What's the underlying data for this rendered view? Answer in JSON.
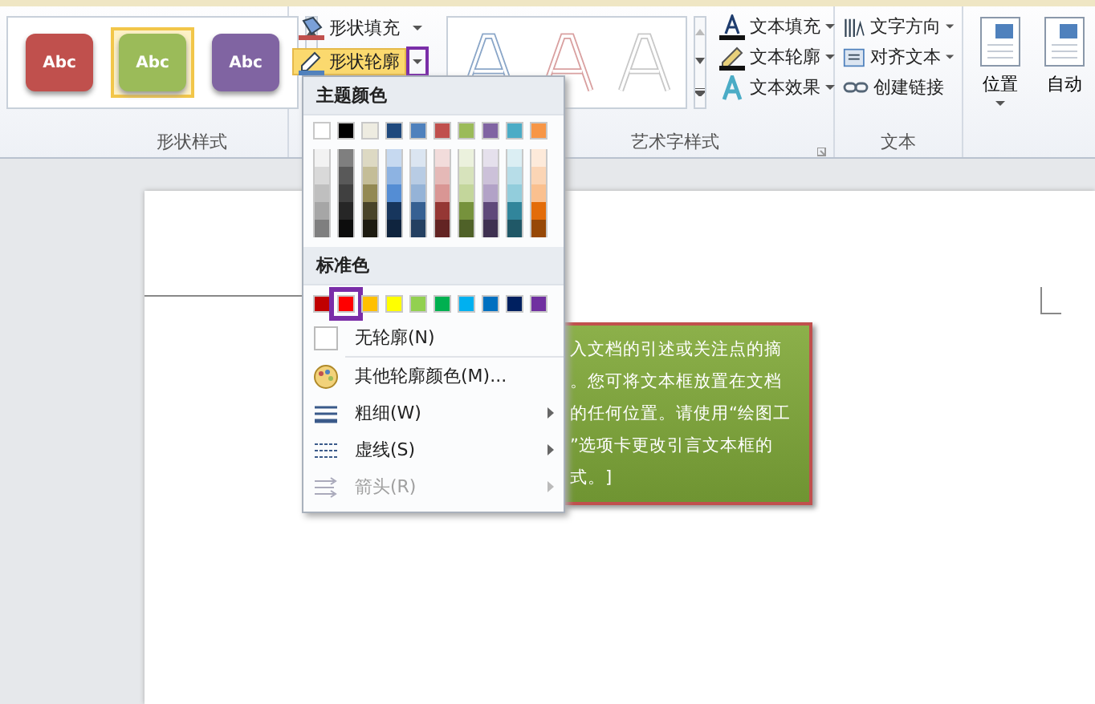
{
  "ribbon": {
    "shape_styles": {
      "label": "形状样式",
      "presets": [
        {
          "text": "Abc",
          "color": "#c0504d",
          "selected": false
        },
        {
          "text": "Abc",
          "color": "#9bbb59",
          "selected": true
        },
        {
          "text": "Abc",
          "color": "#8064a2",
          "selected": false
        }
      ]
    },
    "shape_commands": [
      {
        "kind": "fill",
        "label": "形状填充",
        "expanded": false
      },
      {
        "kind": "outline",
        "label": "形状轮廓",
        "expanded": true
      }
    ],
    "wordart_styles": {
      "label": "艺术字样式",
      "commands": [
        {
          "kind": "fill",
          "label": "文本填充"
        },
        {
          "kind": "outline",
          "label": "文本轮廓"
        },
        {
          "kind": "effect",
          "label": "文本效果"
        }
      ]
    },
    "text_group": {
      "label": "文本",
      "commands": [
        {
          "kind": "direction",
          "label": "文字方向",
          "dropdown": true
        },
        {
          "kind": "align",
          "label": "对齐文本",
          "dropdown": true
        },
        {
          "kind": "link",
          "label": "创建链接",
          "dropdown": false
        }
      ]
    },
    "arrange": [
      {
        "kind": "position",
        "label": "位置"
      },
      {
        "kind": "wrap",
        "label": "自动"
      }
    ]
  },
  "outline_menu": {
    "theme_heading": "主题颜色",
    "theme_colors": [
      {
        "color": "#ffffff",
        "shades": [
          {
            "color": "#f2f2f2"
          },
          {
            "color": "#d9d9d9"
          },
          {
            "color": "#bfbfbf"
          },
          {
            "color": "#a6a6a6"
          },
          {
            "color": "#7f7f7f"
          }
        ]
      },
      {
        "color": "#000000",
        "shades": [
          {
            "color": "#7f7f7f"
          },
          {
            "color": "#595959"
          },
          {
            "color": "#404040"
          },
          {
            "color": "#262626"
          },
          {
            "color": "#0d0d0d"
          }
        ]
      },
      {
        "color": "#eeece1",
        "shades": [
          {
            "color": "#ddd9c3"
          },
          {
            "color": "#c4bd97"
          },
          {
            "color": "#938953"
          },
          {
            "color": "#494429"
          },
          {
            "color": "#1d1b10"
          }
        ]
      },
      {
        "color": "#1f497d",
        "shades": [
          {
            "color": "#c6d9f0"
          },
          {
            "color": "#8db3e2"
          },
          {
            "color": "#548dd4"
          },
          {
            "color": "#17365d"
          },
          {
            "color": "#0f243e"
          }
        ]
      },
      {
        "color": "#4f81bd",
        "shades": [
          {
            "color": "#dbe5f1"
          },
          {
            "color": "#b8cce4"
          },
          {
            "color": "#95b3d7"
          },
          {
            "color": "#366092"
          },
          {
            "color": "#244061"
          }
        ]
      },
      {
        "color": "#c0504d",
        "shades": [
          {
            "color": "#f2dcdb"
          },
          {
            "color": "#e5b9b7"
          },
          {
            "color": "#d99694"
          },
          {
            "color": "#953734"
          },
          {
            "color": "#632423"
          }
        ]
      },
      {
        "color": "#9bbb59",
        "shades": [
          {
            "color": "#ebf1dd"
          },
          {
            "color": "#d7e3bc"
          },
          {
            "color": "#c3d69b"
          },
          {
            "color": "#76923c"
          },
          {
            "color": "#4f6128"
          }
        ]
      },
      {
        "color": "#8064a2",
        "shades": [
          {
            "color": "#e5e0ec"
          },
          {
            "color": "#ccc1d9"
          },
          {
            "color": "#b2a2c7"
          },
          {
            "color": "#5f497a"
          },
          {
            "color": "#3f3151"
          }
        ]
      },
      {
        "color": "#4bacc6",
        "shades": [
          {
            "color": "#dbeef3"
          },
          {
            "color": "#b7dde8"
          },
          {
            "color": "#92cddc"
          },
          {
            "color": "#31859b"
          },
          {
            "color": "#205867"
          }
        ]
      },
      {
        "color": "#f79646",
        "shades": [
          {
            "color": "#fdeada"
          },
          {
            "color": "#fbd5b5"
          },
          {
            "color": "#fac08f"
          },
          {
            "color": "#e36c09"
          },
          {
            "color": "#974806"
          }
        ]
      }
    ],
    "standard_heading": "标准色",
    "standard_colors": [
      {
        "color": "#c00000",
        "selected": false
      },
      {
        "color": "#ff0000",
        "selected": true
      },
      {
        "color": "#ffc000",
        "selected": false
      },
      {
        "color": "#ffff00",
        "selected": false
      },
      {
        "color": "#92d050",
        "selected": false
      },
      {
        "color": "#00b050",
        "selected": false
      },
      {
        "color": "#00b0f0",
        "selected": false
      },
      {
        "color": "#0070c0",
        "selected": false
      },
      {
        "color": "#002060",
        "selected": false
      },
      {
        "color": "#7030a0",
        "selected": false
      }
    ],
    "items": [
      {
        "kind": "none",
        "label": "无轮廓(N)",
        "disabled": false,
        "submenu": false
      },
      {
        "kind": "more",
        "label": "其他轮廓颜色(M)...",
        "disabled": false,
        "submenu": false
      },
      {
        "kind": "weight",
        "label": "粗细(W)",
        "disabled": false,
        "submenu": true
      },
      {
        "kind": "dash",
        "label": "虚线(S)",
        "disabled": false,
        "submenu": true
      },
      {
        "kind": "arrow",
        "label": "箭头(R)",
        "disabled": true,
        "submenu": true
      }
    ]
  },
  "document": {
    "text_box": {
      "lines": [
        "入文档的引述或关注点的摘",
        "。您可将文本框放置在文档",
        "的任何位置。请使用“绘图工",
        "”选项卡更改引言文本框的",
        "式。]"
      ]
    }
  }
}
